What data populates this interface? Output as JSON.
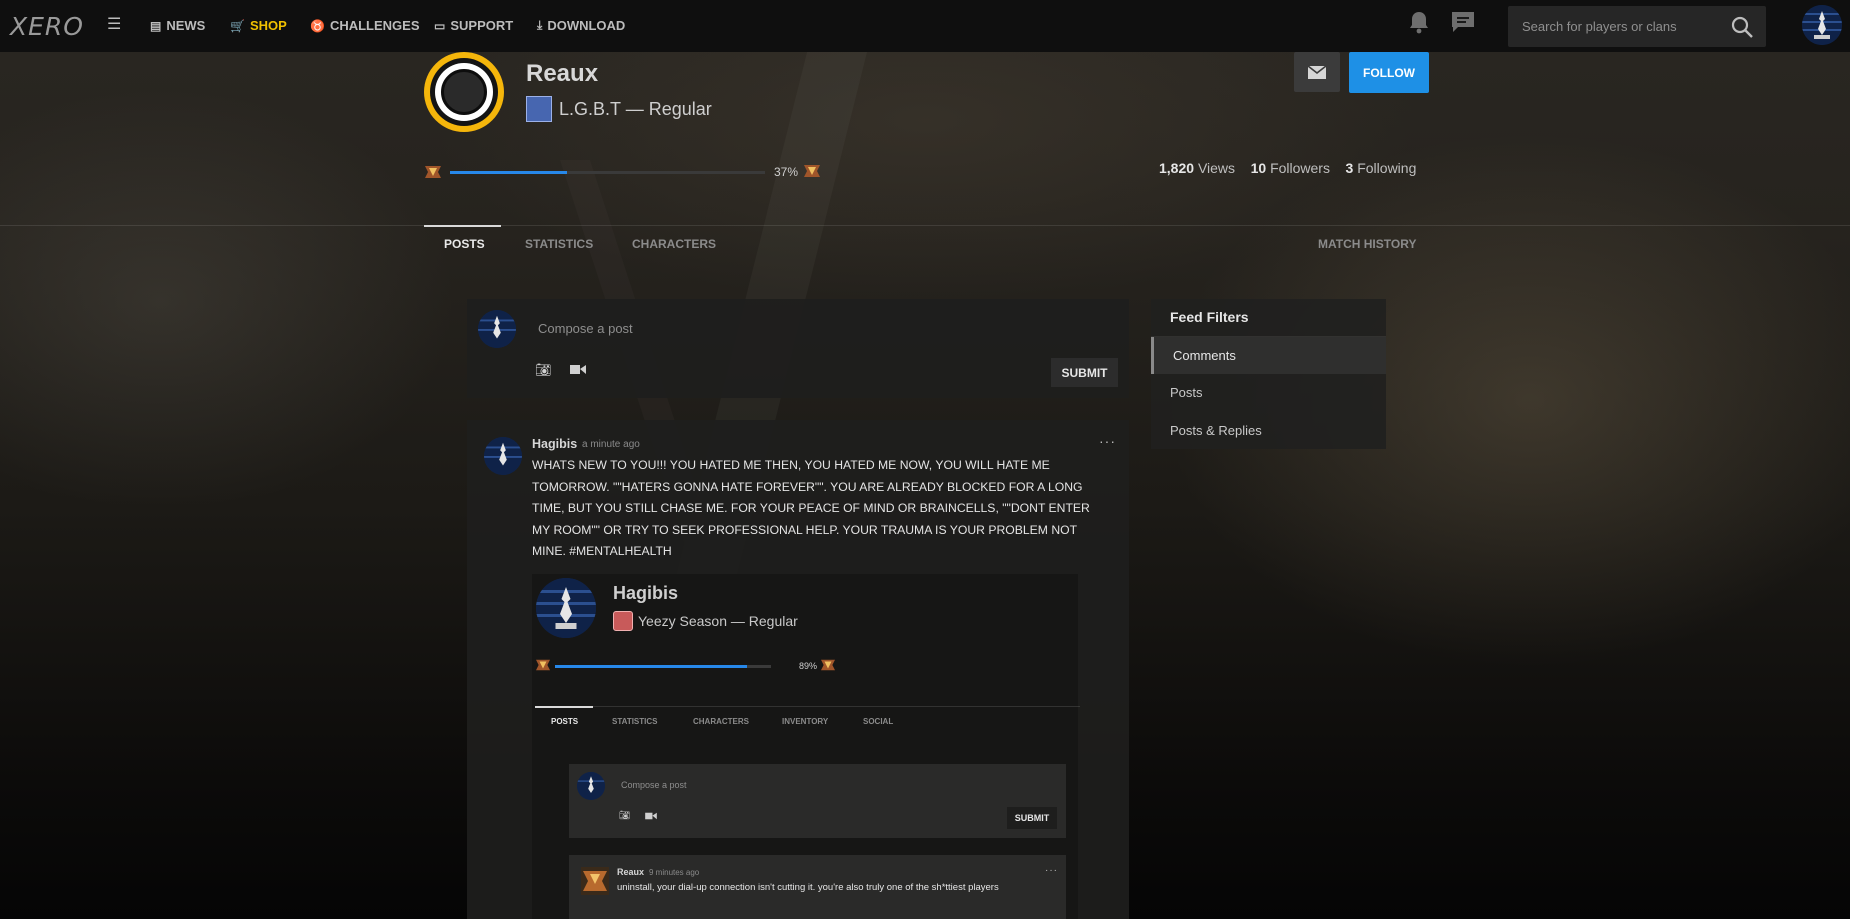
{
  "topbar": {
    "logo": "XERO",
    "nav": [
      {
        "label": "NEWS",
        "icon": "newspaper-icon"
      },
      {
        "label": "SHOP",
        "icon": "cart-icon"
      },
      {
        "label": "CHALLENGES",
        "icon": "medal-icon"
      },
      {
        "label": "SUPPORT",
        "icon": "ticket-icon"
      },
      {
        "label": "DOWNLOAD",
        "icon": "download-icon"
      }
    ],
    "search_placeholder": "Search for players or clans"
  },
  "profile": {
    "name": "Reaux",
    "title": "L.G.B.T — Regular",
    "xp_percent_label": "37%",
    "xp_fraction": 0.37,
    "views_count": "1,820",
    "views_label": "Views",
    "followers_count": "10",
    "followers_label": "Followers",
    "following_count": "3",
    "following_label": "Following",
    "follow_label": "FOLLOW"
  },
  "tabs": [
    {
      "label": "POSTS",
      "active": true
    },
    {
      "label": "STATISTICS",
      "active": false
    },
    {
      "label": "CHARACTERS",
      "active": false
    }
  ],
  "match_history_label": "MATCH HISTORY",
  "composer": {
    "placeholder": "Compose a post",
    "submit_label": "SUBMIT"
  },
  "post": {
    "author": "Hagibis",
    "time": "a minute ago",
    "menu": "···",
    "text": "WHATS NEW TO YOU!!! YOU HATED ME THEN, YOU HATED ME NOW, YOU WILL HATE ME TOMORROW. \"\"HATERS GONNA HATE FOREVER\"\". YOU ARE ALREADY BLOCKED FOR A LONG TIME, BUT YOU STILL CHASE ME. FOR YOUR PEACE OF MIND OR BRAINCELLS, \"\"DONT ENTER MY ROOM\"\" OR TRY TO SEEK PROFESSIONAL HELP. YOUR TRAUMA IS YOUR PROBLEM NOT MINE. #MENTALHEALTH"
  },
  "embedded": {
    "name": "Hagibis",
    "title": "Yeezy Season — Regular",
    "xp_percent_label": "89%",
    "xp_fraction": 0.89,
    "tabs": [
      "POSTS",
      "STATISTICS",
      "CHARACTERS",
      "INVENTORY",
      "SOCIAL"
    ],
    "composer_placeholder": "Compose a post",
    "submit_label": "SUBMIT",
    "comment": {
      "author": "Reaux",
      "time": "9 minutes ago",
      "menu": "···",
      "text": "uninstall, your dial-up connection isn't cutting it. you're also truly one of the sh*ttiest players"
    }
  },
  "feed_filters": {
    "title": "Feed Filters",
    "items": [
      "Comments",
      "Posts",
      "Posts & Replies"
    ],
    "active_index": 0
  },
  "colors": {
    "accent_blue": "#1e90e6",
    "shop_yellow": "#f0c000",
    "avatar_gold": "#f5b60b"
  }
}
